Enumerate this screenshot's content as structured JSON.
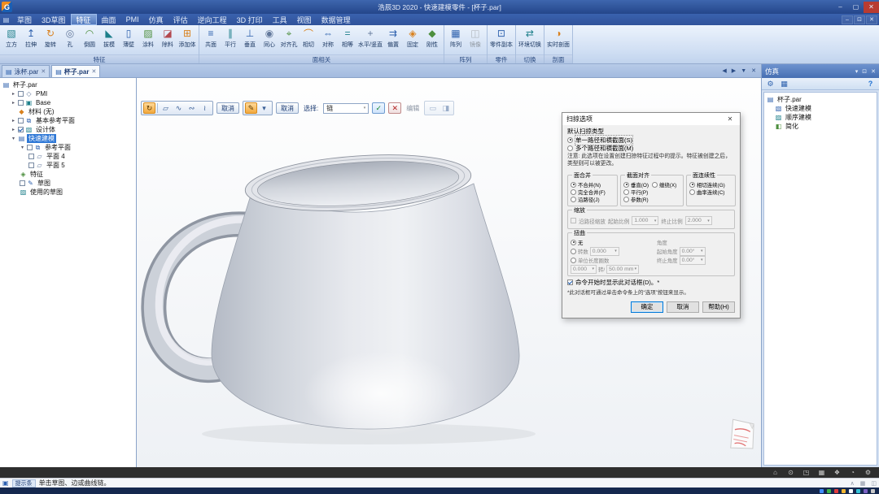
{
  "titlebar": {
    "logo": "G",
    "title": "浩辰3D 2020 - 快速建模零件 - [杯子.par]",
    "minimize": "–",
    "maximize": "▢",
    "close": "✕"
  },
  "menubar": {
    "app_icon": "▤",
    "items": [
      "草图",
      "3D草图",
      "特征",
      "曲面",
      "PMI",
      "仿真",
      "评估",
      "逆向工程",
      "3D 打印",
      "工具",
      "视图",
      "数据管理"
    ],
    "doc_min": "–",
    "doc_restore": "⊡",
    "doc_close": "✕"
  },
  "ribbon": {
    "groups": [
      {
        "label": "特征",
        "buttons": [
          {
            "label": "立方",
            "glyph": "▧"
          },
          {
            "label": "拉伸",
            "glyph": "↥"
          },
          {
            "label": "旋转",
            "glyph": "↻"
          },
          {
            "label": "孔",
            "glyph": "◎"
          },
          {
            "label": "倒圆",
            "glyph": "◠"
          },
          {
            "label": "拔模",
            "glyph": "◣"
          },
          {
            "label": "薄壁",
            "glyph": "▯"
          },
          {
            "label": "涂料",
            "glyph": "▨"
          },
          {
            "label": "除料",
            "glyph": "◪"
          },
          {
            "label": "添加体",
            "glyph": "⊞"
          }
        ]
      },
      {
        "label": "面相关",
        "buttons": [
          {
            "label": "共面",
            "glyph": "≡"
          },
          {
            "label": "平行",
            "glyph": "∥"
          },
          {
            "label": "垂直",
            "glyph": "⊥"
          },
          {
            "label": "同心",
            "glyph": "◉"
          },
          {
            "label": "对齐孔",
            "glyph": "⌖"
          },
          {
            "label": "相切",
            "glyph": "⌒"
          },
          {
            "label": "对称",
            "glyph": "⇔"
          },
          {
            "label": "相等",
            "glyph": "="
          },
          {
            "label": "水平/竖直",
            "glyph": "+"
          },
          {
            "label": "偏置",
            "glyph": "⇉"
          },
          {
            "label": "固定",
            "glyph": "◈"
          },
          {
            "label": "刚性",
            "glyph": "◆"
          }
        ]
      },
      {
        "label": "阵列",
        "buttons": [
          {
            "label": "阵列",
            "glyph": "▦"
          },
          {
            "label": "镜像",
            "glyph": "◫"
          }
        ]
      },
      {
        "label": "零件",
        "buttons": [
          {
            "label": "零件副本",
            "glyph": "⊡"
          }
        ]
      },
      {
        "label": "切换",
        "buttons": [
          {
            "label": "环境切换",
            "glyph": "⇄"
          }
        ]
      },
      {
        "label": "剖面",
        "buttons": [
          {
            "label": "实时剖面",
            "glyph": "◑"
          }
        ]
      }
    ]
  },
  "tabstrip": {
    "tabs": [
      {
        "icon": "▤",
        "label": "泳杯.par",
        "close": "✕"
      },
      {
        "icon": "▤",
        "label": "杯子.par",
        "close": "✕"
      }
    ],
    "nav": [
      "◀",
      "▶",
      "▼",
      "✕"
    ]
  },
  "pathfinder": {
    "items": [
      {
        "label": "杯子.par",
        "icon": "▤"
      },
      {
        "label": "PMI",
        "icon": "◇",
        "exp": "▸"
      },
      {
        "label": "Base",
        "icon": "▣",
        "exp": "▸"
      },
      {
        "label": "材料 (无)",
        "icon": "◆"
      },
      {
        "label": "基本参考平面",
        "icon": "⧉",
        "exp": "▸"
      },
      {
        "label": "设计体",
        "icon": "▧",
        "exp": "▸"
      },
      {
        "label": "快速建模",
        "icon": "▤",
        "exp": "▾"
      },
      {
        "label": "参考平面",
        "icon": "⧉",
        "exp": "▾"
      },
      {
        "label": "平面 4",
        "icon": "▱"
      },
      {
        "label": "平面 5",
        "icon": "▱"
      },
      {
        "label": "特征",
        "icon": "◈"
      },
      {
        "label": "草图",
        "icon": "✎"
      },
      {
        "label": "使用的草图",
        "icon": "▨"
      }
    ]
  },
  "cmdbar": {
    "icons1": [
      "↻",
      "▱",
      "∿",
      "∾",
      "≀"
    ],
    "cancel1": "取消",
    "icons2": [
      "✎",
      "▾"
    ],
    "cancel2": "取消",
    "select_label": "选择:",
    "select_value": "链",
    "dropdown": "▾",
    "accept": "✓",
    "reject": "✕",
    "edit_label": "编辑",
    "icons3": [
      "▭",
      "◨"
    ]
  },
  "dialog": {
    "title": "扫掠选项",
    "close": "✕",
    "type_label": "默认扫掠类型",
    "type_option1": "单一路径和横截面(S)",
    "type_option2": "多个路径和横截面(M)",
    "note": "注意: 此选项在设置创建扫掠特征过程中的提示。特征被创建之后，类型则可以被更改。",
    "merge": {
      "title": "面合并",
      "opt1": "不合并(N)",
      "opt2": "完全合并(F)",
      "opt3": "沿路径(J)"
    },
    "align": {
      "title": "截面对齐",
      "opt1": "垂直(O)",
      "opt2": "平行(P)",
      "opt3": "参数(R)",
      "opt4": "缠绕(X)"
    },
    "continuity": {
      "title": "面连续性",
      "opt1": "相切连续(G)",
      "opt2": "曲率连续(C)"
    },
    "scale": {
      "title": "缩放",
      "checkbox": "沿路径缩放",
      "start_label": "起始比例",
      "start_value": "1.000",
      "end_label": "终止比例",
      "end_value": "2.000"
    },
    "twist": {
      "title": "扭曲",
      "none_label": "无",
      "turns_label": "转数",
      "turns_value": "0.000",
      "angle_label": "角度",
      "start_angle_label": "起始角度",
      "start_angle_value": "0.00°",
      "end_angle_label": "终止角度",
      "end_angle_value": "0.00°",
      "per_length_label": "单位长度圈数",
      "per_length_value": "0.000",
      "per_label": "转/",
      "length_value": "50.00 mm"
    },
    "show_option": "命令开始时显示此对话框(D)。*",
    "footnote": "*此对话框可通过单击命令条上的“选项”按钮来显示。",
    "ok": "确定",
    "cancel": "取消",
    "help": "帮助(H)"
  },
  "sim_panel": {
    "title": "仿真",
    "controls": [
      "▾",
      "⊡",
      "✕"
    ],
    "toolbar": [
      "⚙",
      "▦",
      "?"
    ],
    "items": [
      {
        "label": "杯子.par",
        "icon": "▤"
      },
      {
        "label": "快速建模",
        "icon": "▧"
      },
      {
        "label": "顺序建模",
        "icon": "▨"
      },
      {
        "label": "简化",
        "icon": "◧"
      }
    ]
  },
  "statusbar": {
    "right_icons": [
      "⌂",
      "⊙",
      "◳",
      "▦",
      "❖",
      "◔",
      "⚙"
    ]
  },
  "promptbar": {
    "icon": "▣",
    "badge": "提示条",
    "text": "单击草图、边或曲线链。",
    "right_icons": [
      "∧",
      "▦",
      "◫"
    ]
  }
}
